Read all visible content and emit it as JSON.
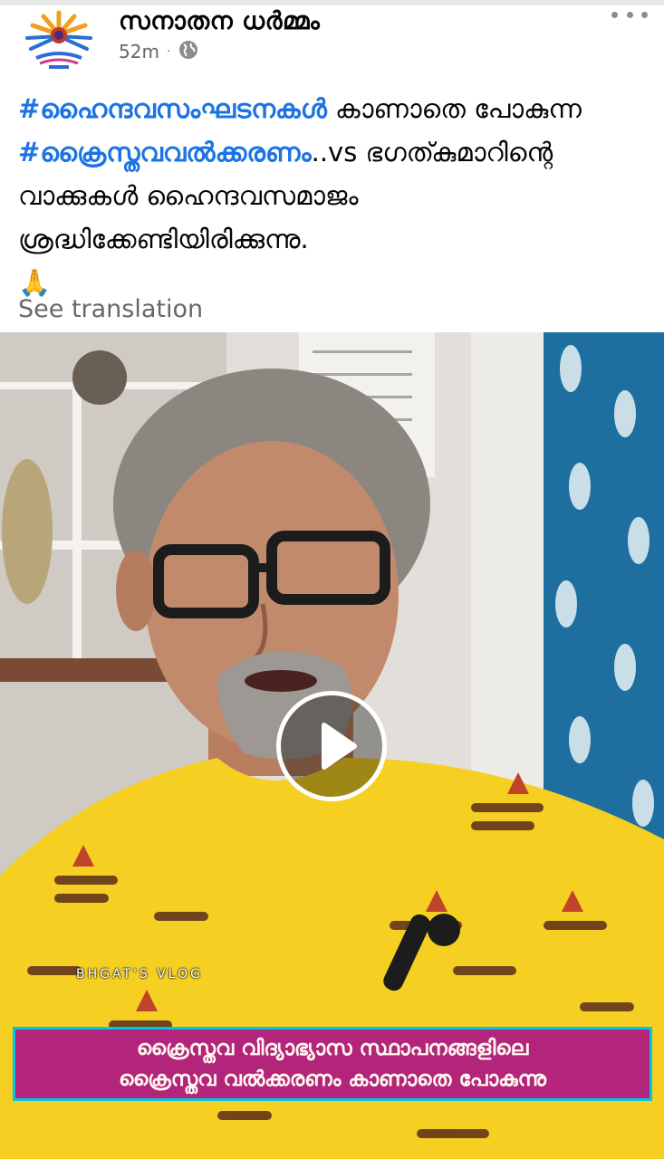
{
  "post": {
    "page_name": "സനാതന ധർമ്മം",
    "time": "52m",
    "separator": "·",
    "audience_icon": "globe-icon",
    "more_icon": "more-options-icon",
    "text_segments": {
      "hashtag_1": "#ഹൈന്ദവസംഘടനകൾ",
      "part_1": " കാണാതെ പോകുന്ന ",
      "hashtag_2": "#ക്രൈസ്തവവൽക്കരണം",
      "part_2": "..vs ഭഗത്കുമാറിന്റെ വാക്കുകൾ ഹൈന്ദവസമാജം ശ്രദ്ധിക്കേണ്ടിയിരിക്കുന്നു.",
      "emoji": "🙏"
    },
    "see_translation": "See translation"
  },
  "video": {
    "play_icon": "play-icon",
    "watermark": "BHGAT'S VLOG",
    "caption_line_1": "ക്രൈസ്തവ വിദ്യാഭ്യാസ സ്ഥാപനങ്ങളിലെ",
    "caption_line_2": "ക്രൈസ്തവ വൽക്കരണം കാണാതെ പോകുന്നു"
  },
  "colors": {
    "hashtag": "#1b74e4",
    "caption_banner": "#b3257a",
    "caption_border": "#00c7e6",
    "shirt": "#f5cf22"
  }
}
